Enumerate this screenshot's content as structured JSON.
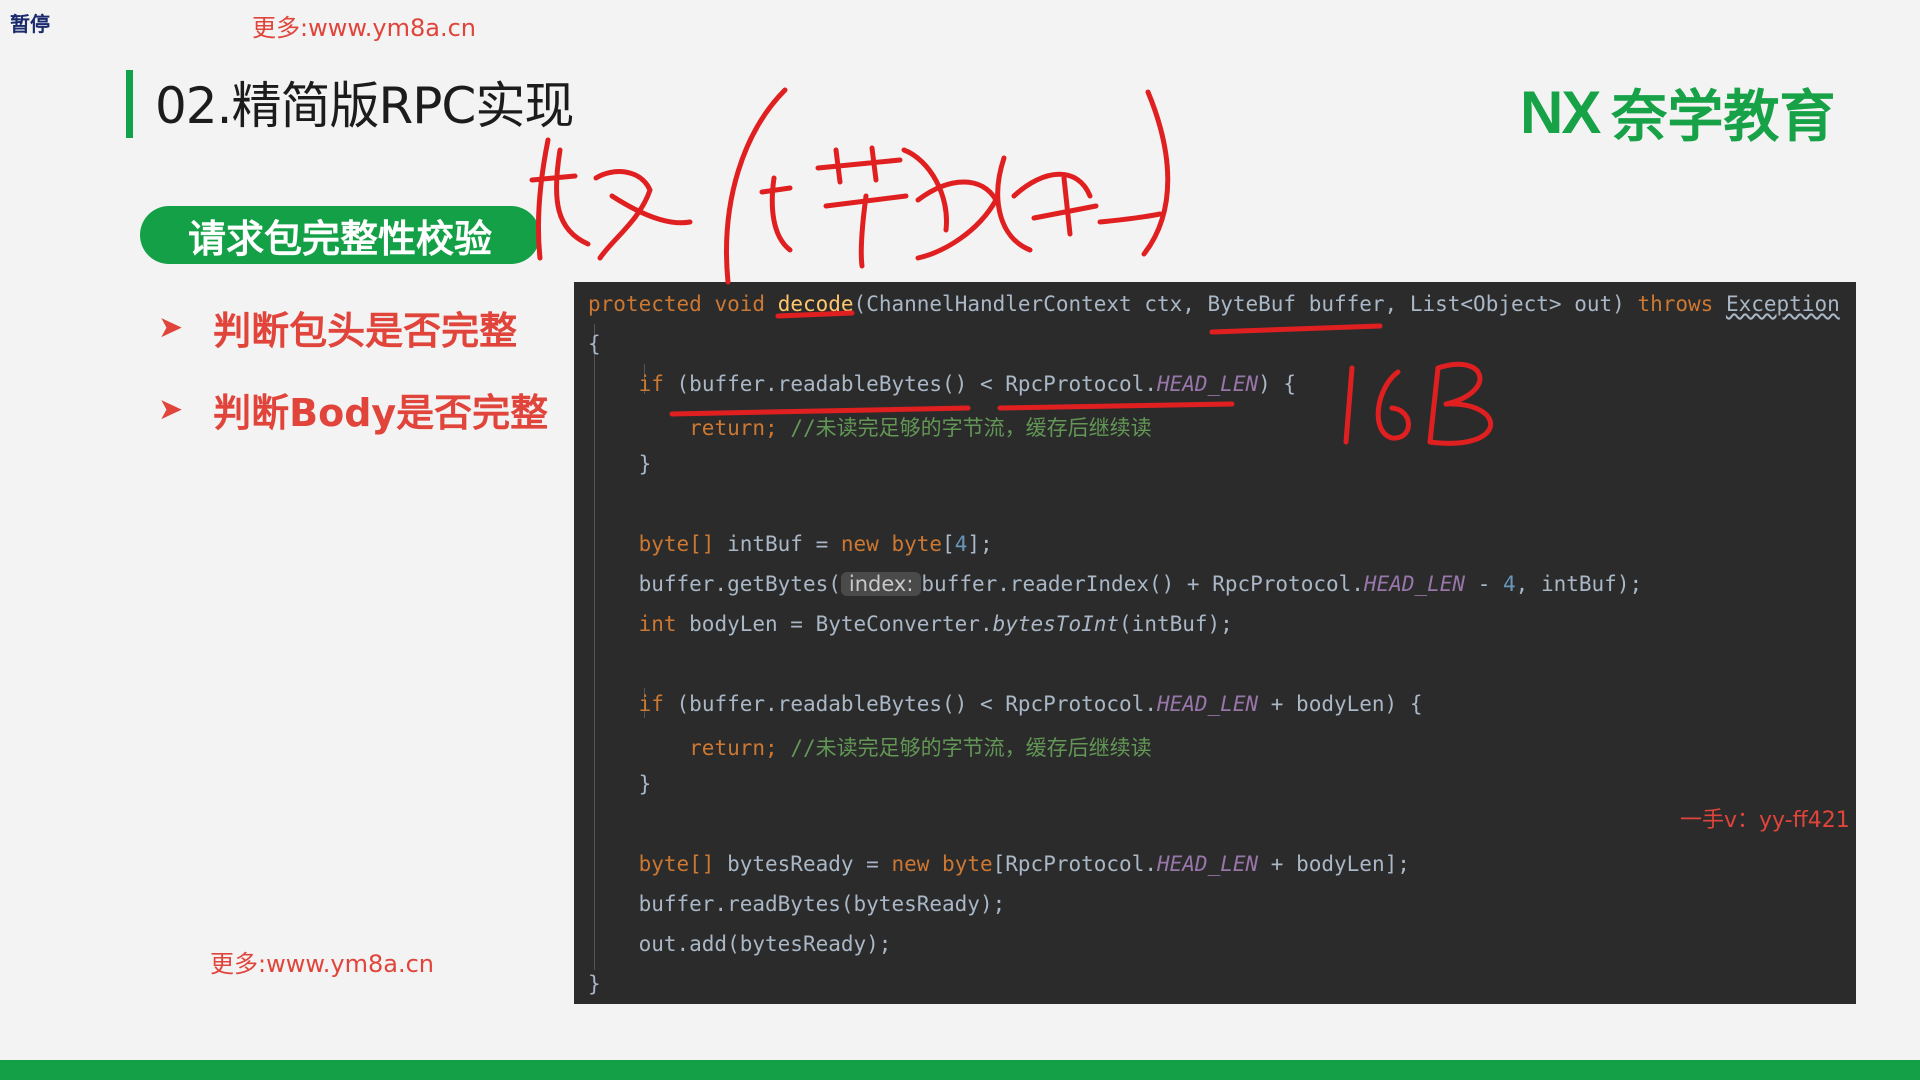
{
  "player": {
    "paused_label": "暂停"
  },
  "watermark": {
    "top": "更多:www.ym8a.cn",
    "bottom": "更多:www.ym8a.cn"
  },
  "slide": {
    "title": "02.精简版RPC实现",
    "logo_mark": "NX",
    "logo_text": "奈学教育",
    "section_pill": "请求包完整性校验",
    "bullets": [
      "判断包头是否完整",
      "判断Body是否完整"
    ],
    "contact": "一手v：yy-ff421"
  },
  "code": {
    "sig_protected": "protected",
    "sig_void": "void",
    "sig_name": "decode",
    "sig_params": "(ChannelHandlerContext ctx, ByteBuf buffer, List<Object> out)",
    "sig_throws": "throws",
    "sig_exception": "Exception",
    "open_brace": "{",
    "close_brace": "}",
    "kw_if": "if",
    "kw_return": "return;",
    "kw_new": "new",
    "kw_byte": "byte",
    "kw_byte_arr": "byte[]",
    "kw_int": "int",
    "head_len": "HEAD_LEN",
    "comment": "//未读完足够的字节流，缓存后继续读",
    "l1_a": "(buffer.readableBytes() < RpcProtocol.",
    "l1_b": ") {",
    "l3_a": " intBuf = ",
    "l3_b": "[",
    "l3_num": "4",
    "l3_c": "];",
    "l4_a": "buffer.getBytes(",
    "l4_hint": "index:",
    "l4_b": "buffer.readerIndex() + RpcProtocol.",
    "l4_c": " - ",
    "l4_num": "4",
    "l4_d": ", intBuf);",
    "l5_a": " bodyLen = ByteConverter.",
    "l5_fn": "bytesToInt",
    "l5_b": "(intBuf);",
    "l6_a": "(buffer.readableBytes() < RpcProtocol.",
    "l6_b": " + bodyLen) {",
    "l7_a": " bytesReady = ",
    "l7_b": "[RpcProtocol.",
    "l7_c": " + bodyLen];",
    "l8": "buffer.readBytes(bytesReady);",
    "l9": "out.add(bytesReady);"
  },
  "annotation": {
    "color": "#e02020",
    "handwritten_text": [
      "接收(字节数组)",
      "16B"
    ]
  }
}
